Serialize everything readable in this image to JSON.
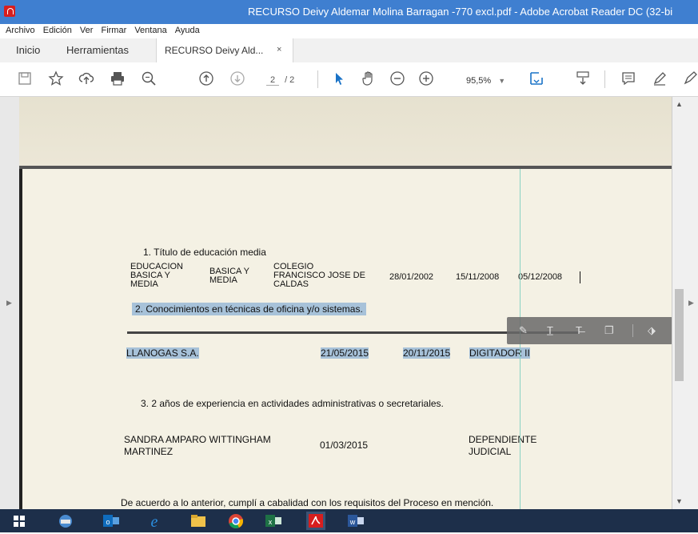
{
  "window": {
    "title": "RECURSO Deivy Aldemar Molina Barragan -770 excl.pdf - Adobe Acrobat Reader DC (32-bi"
  },
  "menu": [
    "Archivo",
    "Edición",
    "Ver",
    "Firmar",
    "Ventana",
    "Ayuda"
  ],
  "tabs": {
    "home": "Inicio",
    "tools": "Herramientas",
    "doc": "RECURSO Deivy Ald...",
    "close": "×"
  },
  "toolbar": {
    "page_current": "2",
    "page_total": "/ 2",
    "zoom": "95,5%"
  },
  "colors": {
    "titlebar": "#3f7fd0",
    "highlight": "#a7c2d9",
    "taskbar": "#1d2f4a"
  },
  "document": {
    "item1_title": "1.   Título de educación media",
    "edu_type_1": "EDUCACION",
    "edu_type_2": "BASICA Y",
    "edu_type_3": "MEDIA",
    "level_1": "BASICA Y",
    "level_2": "MEDIA",
    "school_1": "COLEGIO",
    "school_2": "FRANCISCO JOSE DE",
    "school_3": "CALDAS",
    "date_1": "28/01/2002",
    "date_2": "15/11/2008",
    "date_3": "05/12/2008",
    "item2_title": "2.   Conocimientos en técnicas de oficina y/o sistemas.",
    "company": "LLANOGAS S.A.",
    "job_start": "21/05/2015",
    "job_end": "20/11/2015",
    "job_role": "DIGITADOR II",
    "item3_title": "3.   2 años de experiencia en actividades administrativas o secretariales.",
    "person_1": "SANDRA AMPARO WITTINGHAM",
    "person_2": "MARTINEZ",
    "person_date": "01/03/2015",
    "person_role_1": "DEPENDIENTE",
    "person_role_2": "JUDICIAL",
    "footer_text": "De acuerdo a lo anterior, cumplí a cabalidad con los requisitos del Proceso en mención."
  }
}
